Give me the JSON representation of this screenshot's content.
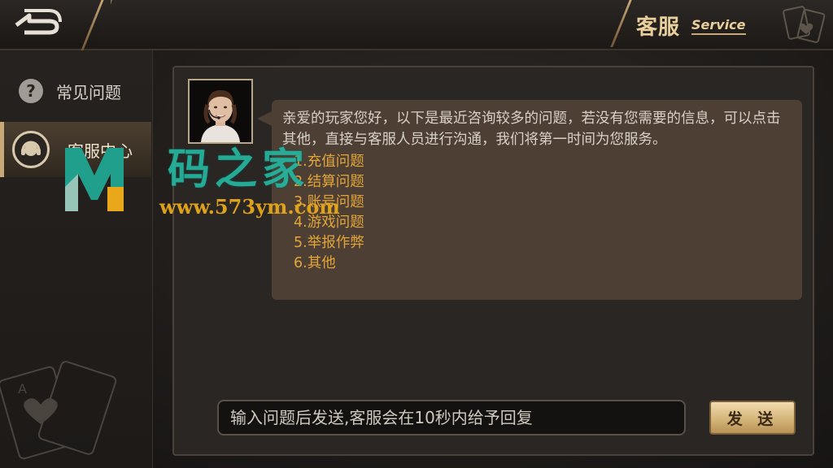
{
  "header": {
    "title_cn": "客服",
    "title_en": "Service"
  },
  "sidebar": {
    "items": [
      {
        "label": "常见问题",
        "icon": "question-icon"
      },
      {
        "label": "客服中心",
        "icon": "headset-icon",
        "active": true
      }
    ]
  },
  "chat": {
    "intro": "亲爱的玩家您好，以下是最近咨询较多的问题，若没有您需要的信息，可以点击其他，直接与客服人员进行沟通，我们将第一时间为您服务。",
    "faq_items": [
      "1.充值问题",
      "2.结算问题",
      "3.账号问题",
      "4.游戏问题",
      "5.举报作弊",
      "6.其他"
    ]
  },
  "input": {
    "placeholder": "输入问题后发送,客服会在10秒内给予回复"
  },
  "send_button": {
    "label": "发 送"
  },
  "watermark": {
    "text_cn": "码之家",
    "url": "www.573ym.com"
  },
  "colors": {
    "accent_gold": "#c9a877",
    "faq_link": "#e3a53a",
    "bubble": "#4d3f34"
  }
}
